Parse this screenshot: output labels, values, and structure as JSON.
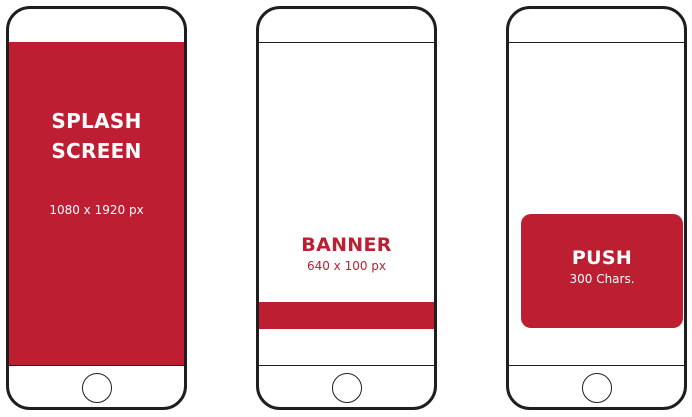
{
  "colors": {
    "accent": "#bd1e32",
    "outline": "#1e1e1e",
    "background": "#ffffff"
  },
  "splash": {
    "title_line1": "SPLASH",
    "title_line2": "SCREEN",
    "size": "1080 x 1920 px"
  },
  "banner": {
    "title": "BANNER",
    "size": "640 x 100 px"
  },
  "push": {
    "title": "PUSH",
    "size": "300 Chars."
  }
}
